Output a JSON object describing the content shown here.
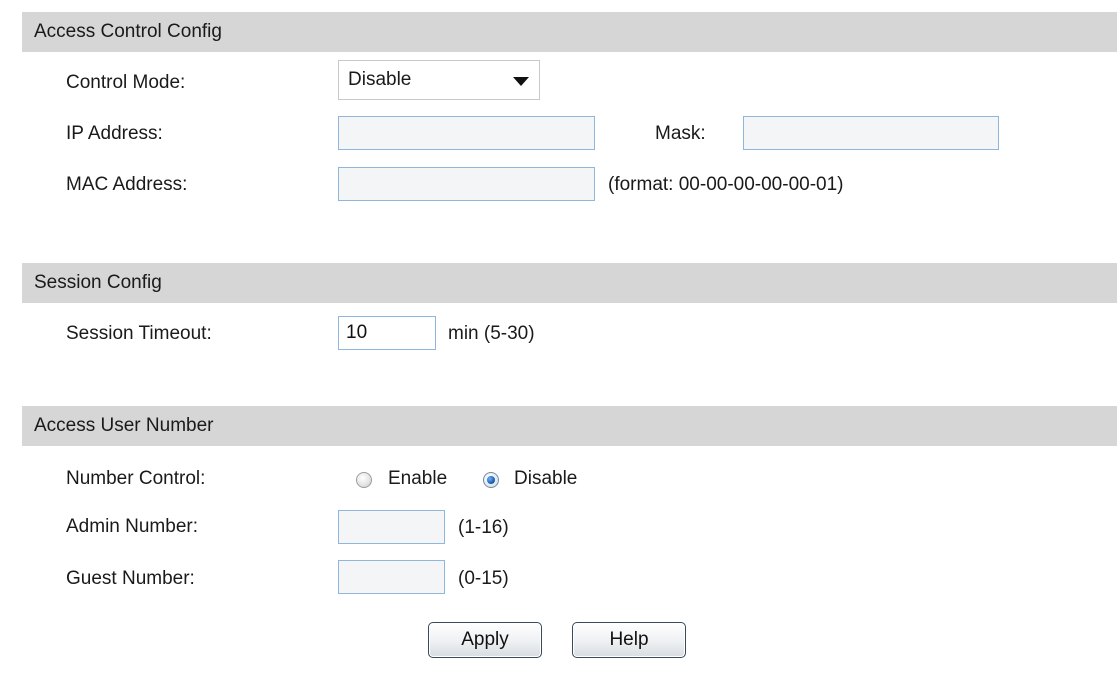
{
  "access_control": {
    "header": "Access Control Config",
    "control_mode_label": "Control Mode:",
    "control_mode_value": "Disable",
    "ip_address_label": "IP Address:",
    "ip_address_value": "",
    "mask_label": "Mask:",
    "mask_value": "",
    "mac_address_label": "MAC Address:",
    "mac_address_value": "",
    "mac_format_hint": "(format: 00-00-00-00-00-01)"
  },
  "session": {
    "header": "Session Config",
    "timeout_label": "Session Timeout:",
    "timeout_value": "10",
    "timeout_hint": "min (5-30)"
  },
  "access_user": {
    "header": "Access User Number",
    "number_control_label": "Number Control:",
    "enable_label": "Enable",
    "disable_label": "Disable",
    "selected": "Disable",
    "admin_number_label": "Admin Number:",
    "admin_number_value": "",
    "admin_number_hint": "(1-16)",
    "guest_number_label": "Guest Number:",
    "guest_number_value": "",
    "guest_number_hint": "(0-15)"
  },
  "buttons": {
    "apply_label": "Apply",
    "help_label": "Help"
  },
  "colors": {
    "section_header_bg": "#d6d6d6",
    "input_border": "#8fb6dc",
    "radio_selected": "#1f5fb0"
  }
}
